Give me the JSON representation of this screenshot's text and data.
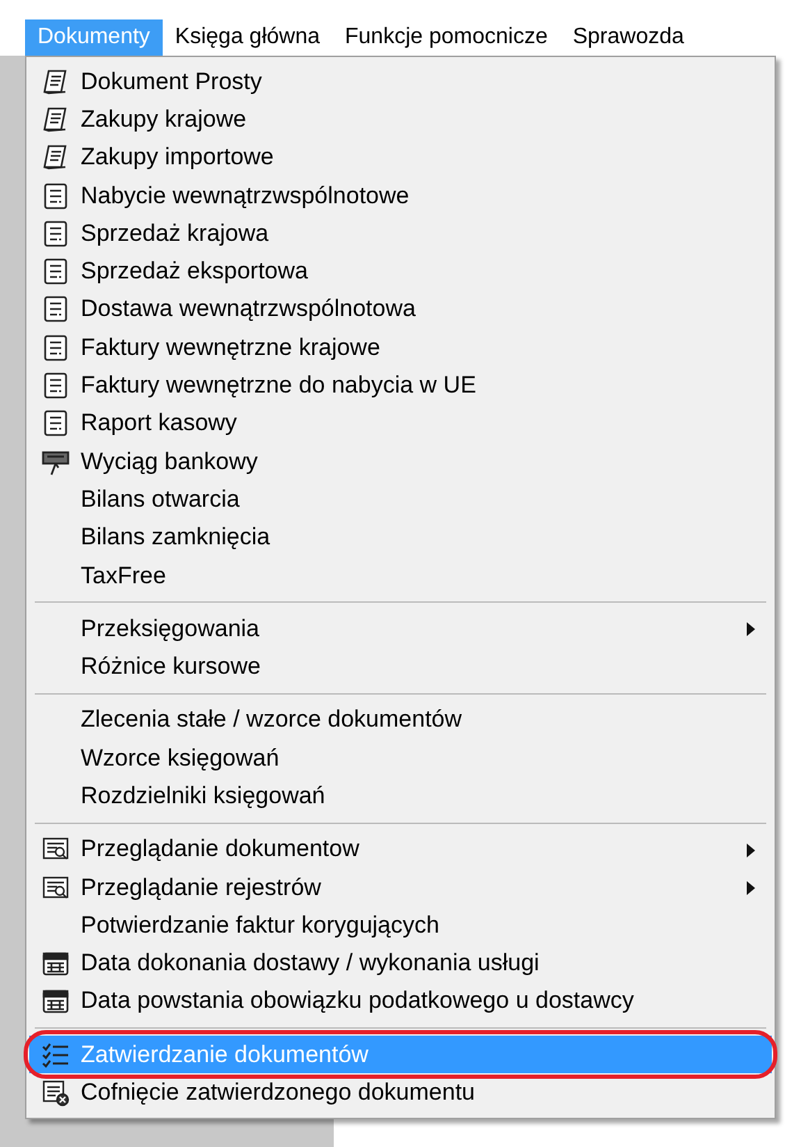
{
  "menu_bar": [
    {
      "label": "Dokumenty",
      "selected": true
    },
    {
      "label": "Księga główna",
      "selected": false
    },
    {
      "label": "Funkcje pomocnicze",
      "selected": false
    },
    {
      "label": "Sprawozda",
      "selected": false
    }
  ],
  "dropdown": {
    "groups": [
      {
        "items": [
          {
            "label": "Dokument Prosty",
            "kind": "pen-doc",
            "submenu": false,
            "selected": false
          },
          {
            "label": "Zakupy krajowe",
            "kind": "pen-doc",
            "submenu": false,
            "selected": false
          },
          {
            "label": "Zakupy importowe",
            "kind": "pen-doc",
            "submenu": false,
            "selected": false
          },
          {
            "label": "Nabycie wewnątrzwspólnotowe",
            "kind": "form",
            "submenu": false,
            "selected": false
          },
          {
            "label": "Sprzedaż krajowa",
            "kind": "form",
            "submenu": false,
            "selected": false
          },
          {
            "label": "Sprzedaż eksportowa",
            "kind": "form",
            "submenu": false,
            "selected": false
          },
          {
            "label": "Dostawa wewnątrzwspólnotowa",
            "kind": "form",
            "submenu": false,
            "selected": false
          },
          {
            "label": "Faktury wewnętrzne krajowe",
            "kind": "form",
            "submenu": false,
            "selected": false
          },
          {
            "label": "Faktury wewnętrzne do nabycia w UE",
            "kind": "form",
            "submenu": false,
            "selected": false
          },
          {
            "label": "Raport kasowy",
            "kind": "report",
            "submenu": false,
            "selected": false
          },
          {
            "label": "Wyciąg bankowy",
            "kind": "bank",
            "submenu": false,
            "selected": false
          },
          {
            "label": "Bilans otwarcia",
            "kind": "plain",
            "submenu": false,
            "selected": false
          },
          {
            "label": "Bilans zamknięcia",
            "kind": "plain",
            "submenu": false,
            "selected": false
          },
          {
            "label": "TaxFree",
            "kind": "plain",
            "submenu": false,
            "selected": false
          }
        ]
      },
      {
        "items": [
          {
            "label": "Przeksięgowania",
            "kind": "plain",
            "submenu": true,
            "selected": false
          },
          {
            "label": "Różnice kursowe",
            "kind": "plain",
            "submenu": false,
            "selected": false
          }
        ]
      },
      {
        "items": [
          {
            "label": "Zlecenia stałe / wzorce dokumentów",
            "kind": "plain",
            "submenu": false,
            "selected": false
          },
          {
            "label": "Wzorce księgowań",
            "kind": "plain",
            "submenu": false,
            "selected": false
          },
          {
            "label": "Rozdzielniki księgowań",
            "kind": "plain",
            "submenu": false,
            "selected": false
          }
        ]
      },
      {
        "items": [
          {
            "label": "Przeglądanie dokumentow",
            "kind": "browse",
            "submenu": true,
            "selected": false
          },
          {
            "label": "Przeglądanie rejestrów",
            "kind": "browse",
            "submenu": true,
            "selected": false
          },
          {
            "label": "Potwierdzanie faktur korygujących",
            "kind": "plain",
            "submenu": false,
            "selected": false
          },
          {
            "label": "Data dokonania dostawy / wykonania usługi",
            "kind": "calendar",
            "submenu": false,
            "selected": false
          },
          {
            "label": "Data powstania obowiązku podatkowego u dostawcy",
            "kind": "calendar",
            "submenu": false,
            "selected": false
          }
        ]
      },
      {
        "items": [
          {
            "label": "Zatwierdzanie dokumentów",
            "kind": "checklist",
            "submenu": false,
            "selected": true,
            "annotated": true
          },
          {
            "label": "Cofnięcie zatwierdzonego dokumentu",
            "kind": "undo-doc",
            "submenu": false,
            "selected": false
          }
        ]
      }
    ]
  }
}
